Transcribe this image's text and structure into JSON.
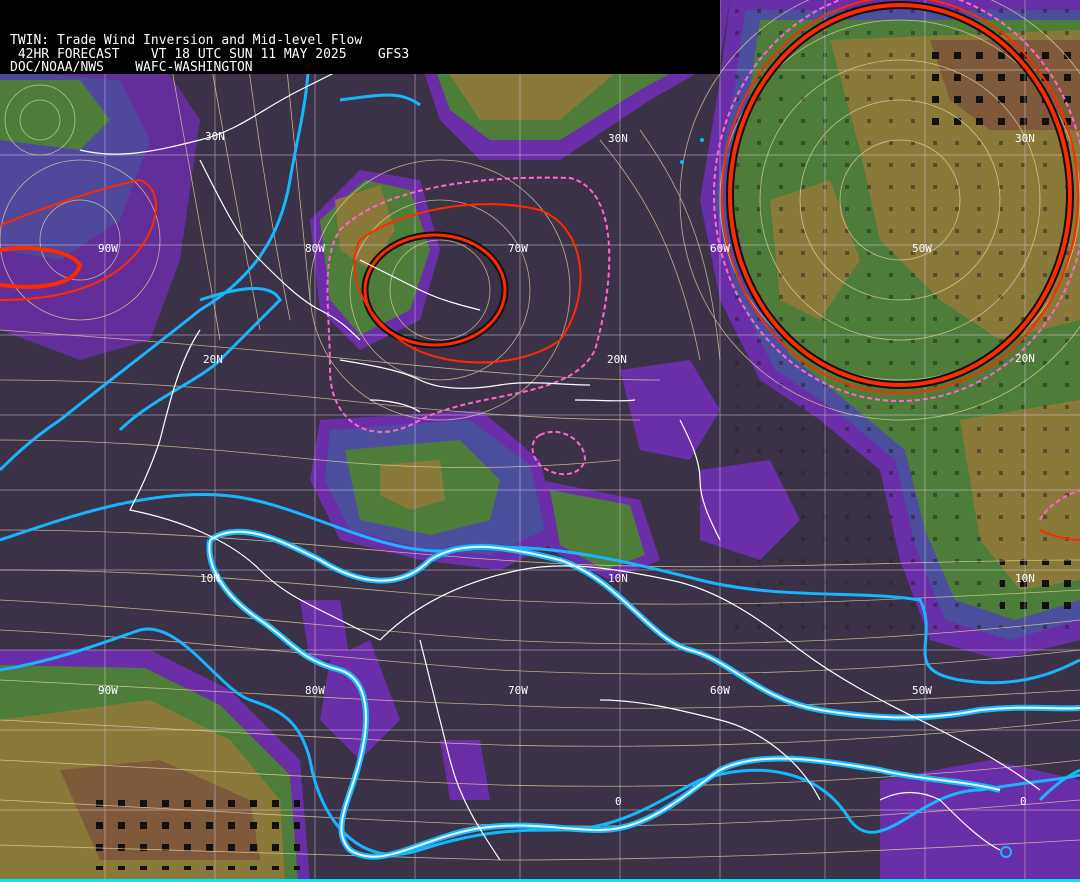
{
  "header": {
    "line1": "TWIN: Trade Wind Inversion and Mid-level Flow",
    "line2": " 42HR FORECAST    VT 18 UTC SUN 11 MAY 2025    GFS3",
    "line3": "DOC/NOAA/NWS    WAFC-WASHINGTON"
  },
  "colors": {
    "background": "#3b3247",
    "purple_band": "#6a2ea8",
    "blue_band": "#4b4f9e",
    "green_band": "#4e7d3a",
    "olive_band": "#8a7a3a",
    "brown_band": "#7e5a3a",
    "red_contour": "#ff2a00",
    "pink_dashed": "#ff66cc",
    "cyan_contour": "#18b6ff",
    "streamline": "#e8d9a0",
    "coastline": "#ffffff"
  },
  "labels": {
    "lat_30n_a": "30N",
    "lat_30n_b": "30N",
    "lat_30n_c": "30N",
    "lat_20n_a": "20N",
    "lat_20n_b": "20N",
    "lat_20n_c": "20N",
    "lat_10n_a": "10N",
    "lat_10n_b": "10N",
    "lat_10n_c": "10N",
    "lat_0_a": "0",
    "lat_0_b": "0",
    "lon_90w_a": "90W",
    "lon_90w_b": "90W",
    "lon_80w_a": "80W",
    "lon_80w_b": "80W",
    "lon_70w_a": "70W",
    "lon_70w_b": "70W",
    "lon_60w_a": "60W",
    "lon_60w_b": "60W",
    "lon_50w_a": "50W",
    "lon_50w_b": "50W"
  }
}
